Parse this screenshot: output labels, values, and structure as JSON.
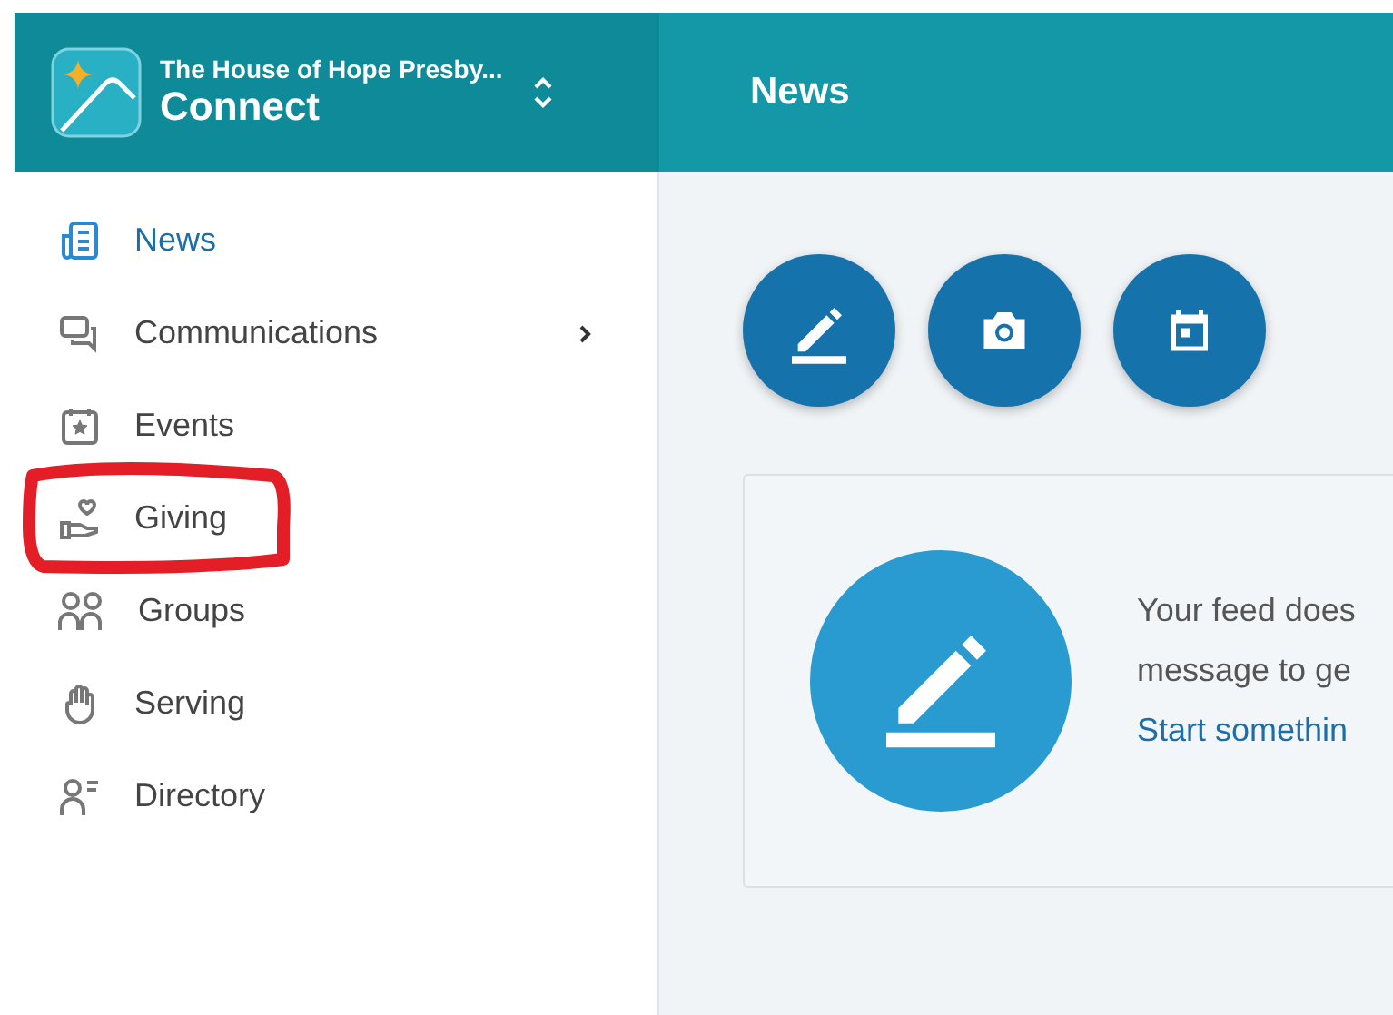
{
  "header": {
    "organization": "The House of Hope Presby...",
    "app_name": "Connect",
    "page_title": "News"
  },
  "sidebar": {
    "items": [
      {
        "label": "News",
        "selected": true,
        "has_submenu": false,
        "circled": false
      },
      {
        "label": "Communications",
        "selected": false,
        "has_submenu": true,
        "circled": false
      },
      {
        "label": "Events",
        "selected": false,
        "has_submenu": false,
        "circled": false
      },
      {
        "label": "Giving",
        "selected": false,
        "has_submenu": false,
        "circled": true
      },
      {
        "label": "Groups",
        "selected": false,
        "has_submenu": false,
        "circled": false
      },
      {
        "label": "Serving",
        "selected": false,
        "has_submenu": false,
        "circled": false
      },
      {
        "label": "Directory",
        "selected": false,
        "has_submenu": false,
        "circled": false
      }
    ]
  },
  "actions": [
    {
      "kind": "post"
    },
    {
      "kind": "photo"
    },
    {
      "kind": "event"
    }
  ],
  "empty_feed": {
    "lines": [
      "Your feed does",
      "message to ge"
    ],
    "link": "Start somethin"
  }
}
